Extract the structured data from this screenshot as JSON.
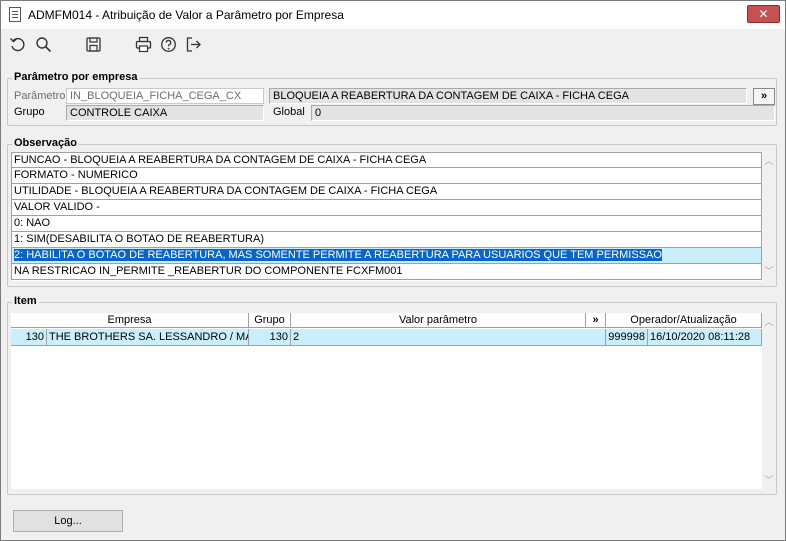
{
  "window": {
    "title": "ADMFM014 - Atribuição de Valor a Parâmetro por Empresa",
    "close_label": "✕"
  },
  "toolbar": {
    "tools": [
      {
        "icon": "undo-icon"
      },
      {
        "icon": "search-icon"
      },
      {
        "icon": "save-icon"
      },
      {
        "icon": "print-icon"
      },
      {
        "icon": "help-icon"
      },
      {
        "icon": "exit-icon"
      }
    ]
  },
  "parametro_group": {
    "legend": "Parâmetro por empresa",
    "parametro_label": "Parâmetro",
    "parametro_value": "IN_BLOQUEIA_FICHA_CEGA_CX",
    "descricao_value": "BLOQUEIA A REABERTURA DA CONTAGEM DE CAIXA - FICHA CEGA",
    "expand_label": "»",
    "grupo_label": "Grupo",
    "grupo_value": "CONTROLE CAIXA",
    "global_label": "Global",
    "global_value": "0"
  },
  "observacao_group": {
    "legend": "Observação",
    "lines": [
      "FUNCAO - BLOQUEIA A REABERTURA DA CONTAGEM DE CAIXA - FICHA CEGA",
      "FORMATO - NUMERICO",
      "UTILIDADE - BLOQUEIA A REABERTURA DA CONTAGEM DE CAIXA - FICHA CEGA",
      "VALOR VALIDO -",
      " 0: NAO",
      " 1: SIM(DESABILITA O BOTAO DE REABERTURA)",
      " 2: HABILITA O BOTAO DE REABERTURA, MAS SOMENTE PERMITE A REABERTURA PARA USUARIOS QUE TEM PERMISSAO",
      "NA RESTRICAO IN_PERMITE _REABERTUR DO COMPONENTE FCXFM001"
    ],
    "selected_index": 6
  },
  "item_group": {
    "legend": "Item",
    "columns": {
      "empresa": "Empresa",
      "grupo": "Grupo",
      "valor": "Valor parâmetro",
      "expand": "»",
      "operador": "Operador/Atualização"
    },
    "row": {
      "empresa_code": "130",
      "empresa_name": "THE BROTHERS SA. LESSANDRO / MARC",
      "grupo": "130",
      "valor": "2",
      "operador": "999998",
      "atualizacao": "16/10/2020 08:11:28"
    }
  },
  "footer": {
    "log_label": "Log..."
  },
  "colors": {
    "selection": "#0a64c8",
    "row_highlight": "#cbeffa",
    "close": "#c75050"
  }
}
